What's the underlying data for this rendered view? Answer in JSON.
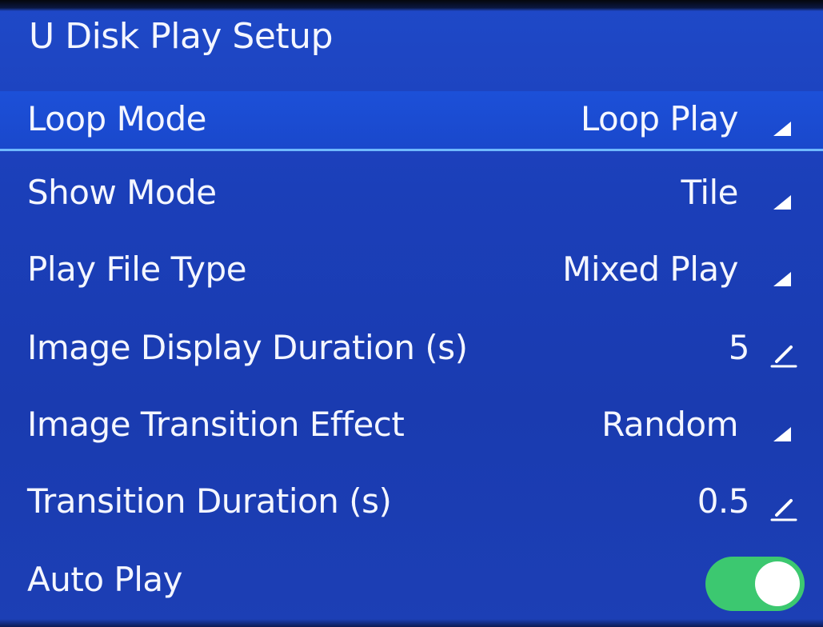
{
  "header": {
    "title": "U Disk Play Setup"
  },
  "settings": {
    "loop_mode": {
      "label": "Loop Mode",
      "value": "Loop Play",
      "icon": "dropdown-triangle-icon"
    },
    "show_mode": {
      "label": "Show Mode",
      "value": "Tile",
      "icon": "dropdown-triangle-icon"
    },
    "play_file_type": {
      "label": "Play File Type",
      "value": "Mixed Play",
      "icon": "dropdown-triangle-icon"
    },
    "image_display_duration": {
      "label": "Image Display Duration (s)",
      "value": "5",
      "icon": "edit-pencil-icon"
    },
    "image_transition_effect": {
      "label": "Image Transition Effect",
      "value": "Random",
      "icon": "dropdown-triangle-icon"
    },
    "transition_duration": {
      "label": "Transition Duration (s)",
      "value": "0.5",
      "icon": "edit-pencil-icon"
    },
    "auto_play": {
      "label": "Auto Play",
      "enabled": true
    }
  },
  "selected_item": "loop_mode",
  "colors": {
    "background": "#1b3fb9",
    "selected_row": "#1c50d8",
    "selection_line": "#6fb9ff",
    "text": "#f4f6ff",
    "toggle_on": "#3cc870"
  }
}
